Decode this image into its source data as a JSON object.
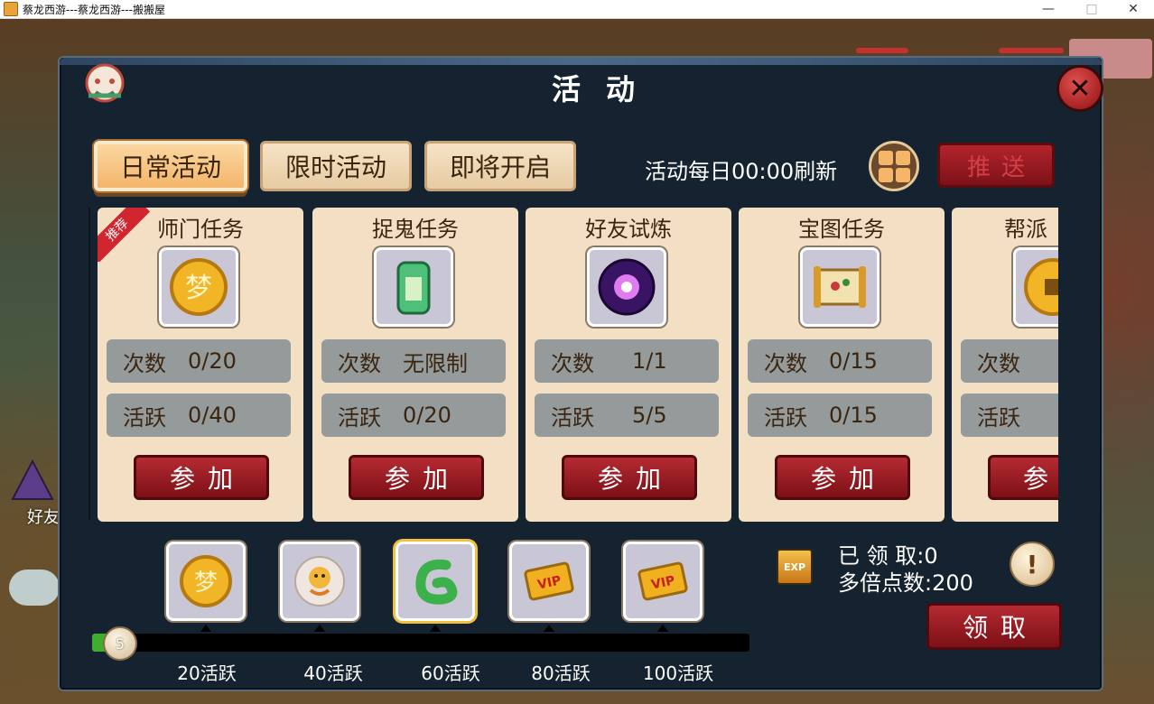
{
  "window": {
    "title": "蔡龙西游---蔡龙西游---搬搬屋",
    "minimize": "—",
    "maximize": "□",
    "close": "✕"
  },
  "background": {
    "side_friend_label": "好友"
  },
  "panel": {
    "title": "活动",
    "tabs": [
      {
        "label": "日常活动",
        "active": true
      },
      {
        "label": "限时活动",
        "active": false
      },
      {
        "label": "即将开启",
        "active": false
      }
    ],
    "refresh_text": "活动每日00:00刷新",
    "push_label": "推送"
  },
  "activities": [
    {
      "name": "师门任务",
      "icon": "gold-coin-icon",
      "badge": "推荐",
      "count_label": "次数",
      "count": "0/20",
      "active_label": "活跃",
      "active": "0/40",
      "join_label": "参加"
    },
    {
      "name": "捉鬼任务",
      "icon": "jade-talisman-icon",
      "count_label": "次数",
      "count": "无限制",
      "active_label": "活跃",
      "active": "0/20",
      "join_label": "参加"
    },
    {
      "name": "好友试炼",
      "icon": "purple-orb-icon",
      "count_label": "次数",
      "count": "1/1",
      "active_label": "活跃",
      "active": "5/5",
      "join_label": "参加"
    },
    {
      "name": "宝图任务",
      "icon": "treasure-map-icon",
      "count_label": "次数",
      "count": "0/15",
      "active_label": "活跃",
      "active": "0/15",
      "join_label": "参加"
    },
    {
      "name": "帮派",
      "icon": "gold-coin-icon",
      "count_label": "次数",
      "count": "",
      "active_label": "活跃",
      "active": "",
      "join_label": "参"
    }
  ],
  "rewards": {
    "items": [
      {
        "icon": "gold-coin-icon",
        "milestone": "20活跃",
        "selected": false
      },
      {
        "icon": "golden-dragon-icon",
        "milestone": "40活跃",
        "selected": false
      },
      {
        "icon": "jade-dragon-icon",
        "milestone": "60活跃",
        "selected": true
      },
      {
        "icon": "vip-card-icon",
        "milestone": "80活跃",
        "selected": false
      },
      {
        "icon": "vip-card-icon",
        "milestone": "100活跃",
        "selected": false
      }
    ],
    "current_activity": "5",
    "progress_fraction": 0.04,
    "exp_icon_text": "EXP",
    "claimed_text": "已 领 取:0",
    "multiplier_text": "多倍点数:200",
    "claim_label": "领取",
    "info_symbol": "!"
  },
  "colors": {
    "panel_bg": "#15222f",
    "card_bg": "#f3dfc4",
    "button_red": "#b52a32",
    "tab_active": "#f3b56a",
    "progress_green": "#3fae2e"
  }
}
